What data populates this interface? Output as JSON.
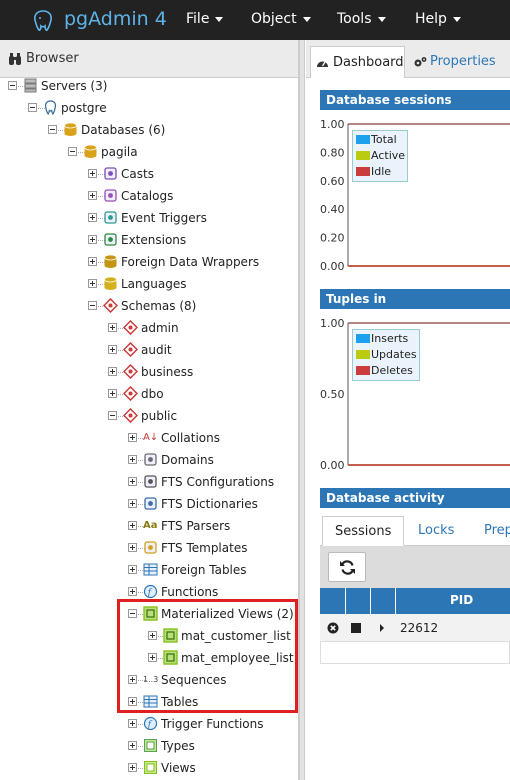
{
  "app": {
    "title": "pgAdmin 4",
    "accent": "#2c76b5",
    "navbar_bg": "#222222"
  },
  "menu": [
    {
      "label": "File"
    },
    {
      "label": "Object"
    },
    {
      "label": "Tools"
    },
    {
      "label": "Help"
    }
  ],
  "browser": {
    "title": "Browser",
    "tree": [
      {
        "label": "Servers (3)",
        "icon": "servers-icon",
        "expanded": true
      },
      {
        "label": "postgre",
        "icon": "elephant-icon",
        "expanded": true
      },
      {
        "label": "Databases (6)",
        "icon": "databases-icon",
        "expanded": true
      },
      {
        "label": "pagila",
        "icon": "database-icon",
        "expanded": true
      },
      {
        "label": "Casts",
        "icon": "casts-icon",
        "expanded": false
      },
      {
        "label": "Catalogs",
        "icon": "catalogs-icon",
        "expanded": false
      },
      {
        "label": "Event Triggers",
        "icon": "event-triggers-icon",
        "expanded": false
      },
      {
        "label": "Extensions",
        "icon": "extensions-icon",
        "expanded": false
      },
      {
        "label": "Foreign Data Wrappers",
        "icon": "fdw-icon",
        "expanded": false
      },
      {
        "label": "Languages",
        "icon": "languages-icon",
        "expanded": false
      },
      {
        "label": "Schemas (8)",
        "icon": "schemas-icon",
        "expanded": true
      },
      {
        "label": "admin",
        "icon": "schema-icon",
        "expanded": false
      },
      {
        "label": "audit",
        "icon": "schema-icon",
        "expanded": false
      },
      {
        "label": "business",
        "icon": "schema-icon",
        "expanded": false
      },
      {
        "label": "dbo",
        "icon": "schema-icon",
        "expanded": false
      },
      {
        "label": "public",
        "icon": "schema-icon",
        "expanded": true
      },
      {
        "label": "Collations",
        "icon": "collations-icon",
        "expanded": false
      },
      {
        "label": "Domains",
        "icon": "domains-icon",
        "expanded": false
      },
      {
        "label": "FTS Configurations",
        "icon": "fts-config-icon",
        "expanded": false
      },
      {
        "label": "FTS Dictionaries",
        "icon": "fts-dict-icon",
        "expanded": false
      },
      {
        "label": "FTS Parsers",
        "icon": "fts-parsers-icon",
        "expanded": false
      },
      {
        "label": "FTS Templates",
        "icon": "fts-templates-icon",
        "expanded": false
      },
      {
        "label": "Foreign Tables",
        "icon": "foreign-tables-icon",
        "expanded": false
      },
      {
        "label": "Functions",
        "icon": "functions-icon",
        "expanded": false
      },
      {
        "label": "Materialized Views (2)",
        "icon": "mview-icon",
        "expanded": true
      },
      {
        "label": "mat_customer_list",
        "icon": "mview-icon",
        "expanded": false
      },
      {
        "label": "mat_employee_list",
        "icon": "mview-icon",
        "expanded": false
      },
      {
        "label": "Sequences",
        "icon": "sequences-icon",
        "icon_text": "1..3",
        "expanded": false
      },
      {
        "label": "Tables",
        "icon": "tables-icon",
        "expanded": false
      },
      {
        "label": "Trigger Functions",
        "icon": "trigger-functions-icon",
        "expanded": false
      },
      {
        "label": "Types",
        "icon": "types-icon",
        "expanded": false
      },
      {
        "label": "Views",
        "icon": "views-icon",
        "expanded": false
      }
    ]
  },
  "dashboard": {
    "tabs": [
      {
        "label": "Dashboard",
        "icon": "dashboard-icon"
      },
      {
        "label": "Properties",
        "icon": "properties-icon"
      }
    ],
    "sessions": {
      "title": "Database sessions",
      "legend": [
        {
          "label": "Total",
          "color": "#1ea1ec"
        },
        {
          "label": "Active",
          "color": "#b9cc12"
        },
        {
          "label": "Idle",
          "color": "#cb3c3c"
        }
      ]
    },
    "tuples": {
      "title": "Tuples in",
      "legend": [
        {
          "label": "Inserts",
          "color": "#1ea1ec"
        },
        {
          "label": "Updates",
          "color": "#b9cc12"
        },
        {
          "label": "Deletes",
          "color": "#cb3c3c"
        }
      ]
    },
    "activity": {
      "title": "Database activity",
      "subtabs": [
        "Sessions",
        "Locks",
        "Prep"
      ],
      "column_pid": "PID",
      "rows": [
        {
          "pid": "22612"
        }
      ]
    }
  },
  "chart_data": [
    {
      "type": "line",
      "title": "Database sessions",
      "ylim": [
        0,
        1
      ],
      "y_ticks": [
        "1.00",
        "0.80",
        "0.60",
        "0.40",
        "0.20",
        "0.00"
      ],
      "series": [
        {
          "name": "Total",
          "color": "#1ea1ec",
          "values": [
            0,
            0,
            0,
            0,
            0
          ]
        },
        {
          "name": "Active",
          "color": "#b9cc12",
          "values": [
            0,
            0,
            0,
            0,
            0
          ]
        },
        {
          "name": "Idle",
          "color": "#cb3c3c",
          "values": [
            0,
            0,
            0,
            0,
            0
          ]
        }
      ],
      "legend_position": "top-left"
    },
    {
      "type": "line",
      "title": "Tuples in",
      "ylim": [
        0,
        1
      ],
      "y_ticks": [
        "1.00",
        "0.50",
        "0.00"
      ],
      "series": [
        {
          "name": "Inserts",
          "color": "#1ea1ec",
          "values": [
            0,
            0,
            0,
            0,
            0
          ]
        },
        {
          "name": "Updates",
          "color": "#b9cc12",
          "values": [
            0,
            0,
            0,
            0,
            0
          ]
        },
        {
          "name": "Deletes",
          "color": "#cb3c3c",
          "values": [
            0,
            0,
            0,
            0,
            0
          ]
        }
      ],
      "legend_position": "top-left"
    }
  ]
}
